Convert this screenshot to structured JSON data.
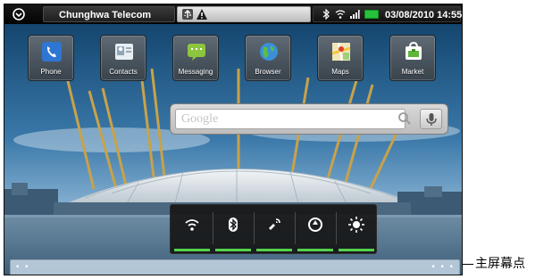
{
  "status_bar": {
    "carrier": "Chunghwa Telecom",
    "datetime": "03/08/2010 14:55",
    "icons": [
      "menu-circle-icon",
      "usb-icon",
      "warning-icon",
      "bluetooth-icon",
      "wifi-icon",
      "signal-icon",
      "battery-icon"
    ],
    "battery_color": "#27c13b"
  },
  "apps": [
    {
      "label": "Phone",
      "icon": "phone-icon"
    },
    {
      "label": "Contacts",
      "icon": "contacts-icon"
    },
    {
      "label": "Messaging",
      "icon": "messaging-icon"
    },
    {
      "label": "Browser",
      "icon": "browser-icon"
    },
    {
      "label": "Maps",
      "icon": "maps-icon"
    },
    {
      "label": "Market",
      "icon": "market-icon"
    }
  ],
  "search": {
    "placeholder": "Google",
    "icons": [
      "search-icon",
      "microphone-icon"
    ]
  },
  "power_control": {
    "toggles": [
      "wifi-toggle",
      "bluetooth-toggle",
      "gps-toggle",
      "sync-toggle",
      "brightness-toggle"
    ],
    "active_color": "#54d24b"
  },
  "home_indicator": {
    "dots_left": "• •",
    "dots_right": "• • •"
  },
  "callout": {
    "label": "主屏幕点"
  }
}
